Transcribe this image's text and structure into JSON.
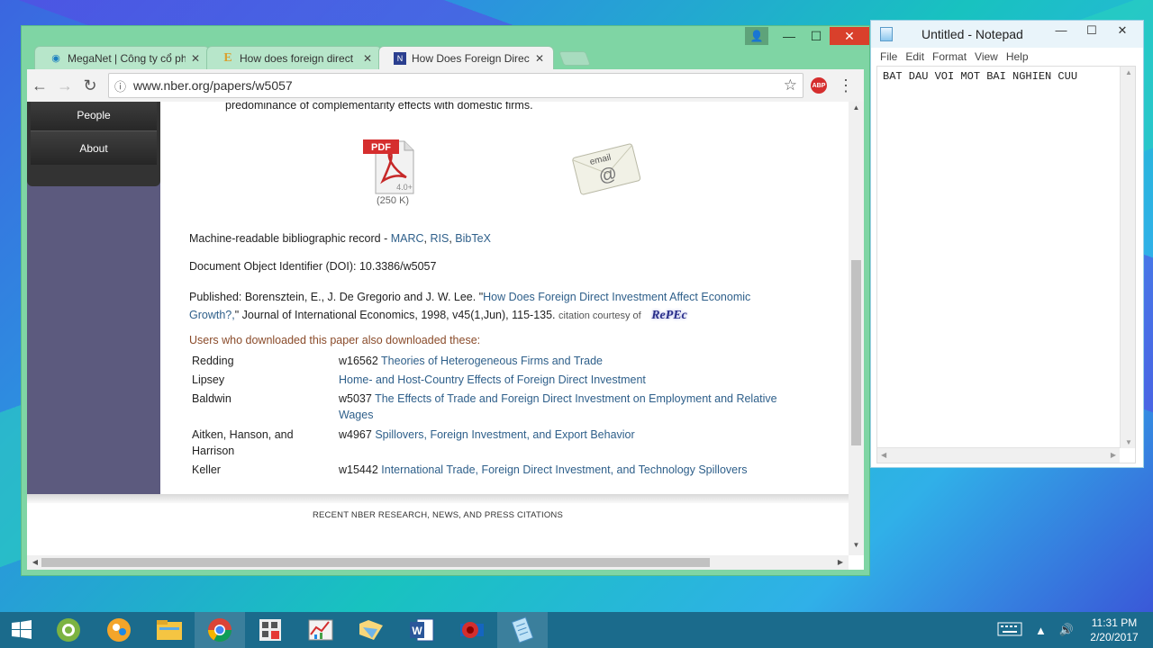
{
  "chrome": {
    "tabs": [
      {
        "title": "MegaNet | Công ty cổ phần",
        "favicon": "meganet-icon"
      },
      {
        "title": "How does foreign direct",
        "favicon": "e-icon"
      },
      {
        "title": "How Does Foreign Direct",
        "favicon": "nber-icon",
        "active": true
      }
    ],
    "url": "www.nber.org/papers/w5057"
  },
  "page": {
    "sidebar": {
      "people": "People",
      "about": "About"
    },
    "abstract_tail": "predominance of complementarity effects with domestic firms.",
    "pdf_label": "PDF",
    "pdf_version": "4.0+",
    "pdf_size": "(250 K)",
    "email_label": "email",
    "biblio_label": "Machine-readable bibliographic record - ",
    "biblio_links": [
      "MARC",
      "RIS",
      "BibTeX"
    ],
    "doi": "Document Object Identifier (DOI): 10.3386/w5057",
    "published_prefix": "Published: Borensztein, E., J. De Gregorio and J. W. Lee. \"",
    "published_link_1": "How Does Foreign Direct Investment Affect Economic",
    "published_link_2": "Growth?,",
    "published_suffix": "\" Journal of International Economics, 1998, v45(1,Jun), 115-135.",
    "citation_note": "citation courtesy of",
    "repec": "RePEc",
    "also_heading": "Users who downloaded this paper also downloaded these:",
    "also": [
      {
        "author": "Redding",
        "id": "w16562",
        "title": "Theories of Heterogeneous Firms and Trade"
      },
      {
        "author": "Lipsey",
        "id": "",
        "title": "Home- and Host-Country Effects of Foreign Direct Investment"
      },
      {
        "author": "Baldwin",
        "id": "w5037",
        "title": "The Effects of Trade and Foreign Direct Investment on Employment and Relative Wages"
      },
      {
        "author": "Aitken, Hanson, and Harrison",
        "id": "w4967",
        "title": "Spillovers, Foreign Investment, and Export Behavior"
      },
      {
        "author": "Keller",
        "id": "w15442",
        "title": "International Trade, Foreign Direct Investment, and Technology Spillovers"
      }
    ],
    "footer": "RECENT NBER RESEARCH, NEWS, AND PRESS CITATIONS"
  },
  "notepad": {
    "title": "Untitled - Notepad",
    "menu": [
      "File",
      "Edit",
      "Format",
      "View",
      "Help"
    ],
    "text": "BAT DAU VOI MOT BAI NGHIEN CUU"
  },
  "taskbar": {
    "time": "11:31 PM",
    "date": "2/20/2017",
    "apps": [
      "start-icon",
      "coccoc-icon",
      "people-app-icon",
      "file-explorer-icon",
      "chrome-icon",
      "calendar-app-icon",
      "chart-app-icon",
      "folder-app-icon",
      "word-icon",
      "recorder-icon",
      "notepad-icon"
    ]
  }
}
